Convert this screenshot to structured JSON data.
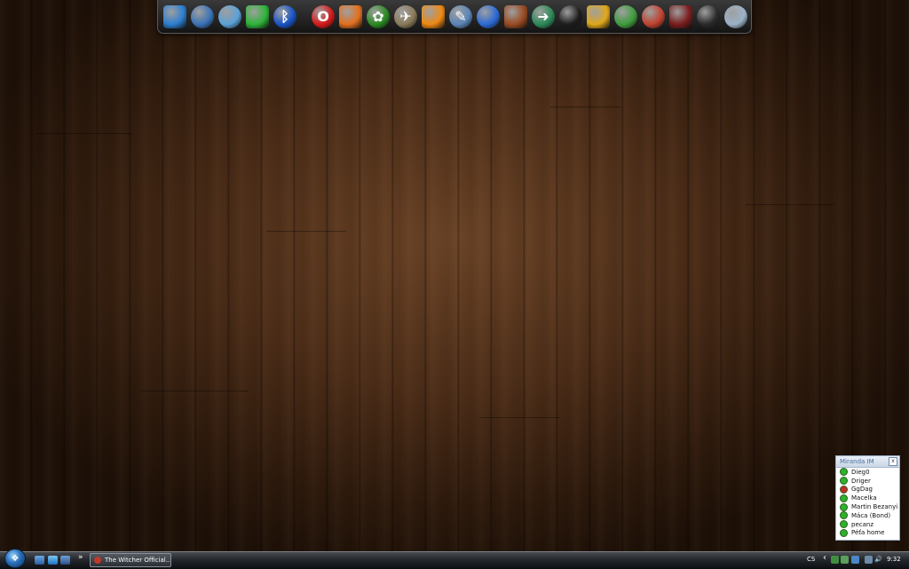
{
  "dock": {
    "icons": [
      {
        "name": "computer-monitor-icon",
        "glyph": "",
        "bg": "#2d7fd1"
      },
      {
        "name": "floppy-save-icon",
        "glyph": "",
        "bg": "#3a72b7"
      },
      {
        "name": "network-devices-icon",
        "glyph": "",
        "bg": "#5aa2d8"
      },
      {
        "name": "green-orb-icon",
        "glyph": "",
        "bg": "#2fb43a"
      },
      {
        "name": "bluetooth-icon",
        "glyph": "ᛒ",
        "bg": "#1853c6"
      },
      {
        "name": "opera-browser-icon",
        "glyph": "O",
        "bg": "#d61a1a"
      },
      {
        "name": "firefox-browser-icon",
        "glyph": "",
        "bg": "#e4701e"
      },
      {
        "name": "icq-flower-icon",
        "glyph": "✿",
        "bg": "#2a8a22"
      },
      {
        "name": "satellite-tools-icon",
        "glyph": "✈",
        "bg": "#8a7a5a"
      },
      {
        "name": "orange-sun-icon",
        "glyph": "",
        "bg": "#f08a12"
      },
      {
        "name": "pen-editor-icon",
        "glyph": "✎",
        "bg": "#5b86b8"
      },
      {
        "name": "water-drop-icon",
        "glyph": "",
        "bg": "#2b6ad6"
      },
      {
        "name": "fire-disc-icon",
        "glyph": "",
        "bg": "#9a4b23"
      },
      {
        "name": "document-arrow-icon",
        "glyph": "➜",
        "bg": "#2c8a58"
      },
      {
        "name": "black-monitor-icon",
        "glyph": "",
        "bg": "#1d1d1d"
      },
      {
        "name": "hexagon-honeycomb-icon",
        "glyph": "",
        "bg": "#e0a81a"
      },
      {
        "name": "globe-network-icon",
        "glyph": "",
        "bg": "#3e9c3c"
      },
      {
        "name": "pencil-eraser-icon",
        "glyph": "",
        "bg": "#c0412e"
      },
      {
        "name": "character-portrait-icon",
        "glyph": "",
        "bg": "#7a1d1d"
      },
      {
        "name": "witcher-wolf-icon",
        "glyph": "",
        "bg": "#2a2a2a"
      },
      {
        "name": "recycle-bin-icon",
        "glyph": "",
        "bg": "#9bb3c8"
      }
    ]
  },
  "miranda": {
    "title": "Miranda IM",
    "close_label": "x",
    "contacts": [
      {
        "name": "Dieg0",
        "color": "#2bb32b"
      },
      {
        "name": "Driger",
        "color": "#2bb32b"
      },
      {
        "name": "GgDag",
        "color": "#c62a2a"
      },
      {
        "name": "Macelka",
        "color": "#2bb32b"
      },
      {
        "name": "Martin Bezanyi",
        "color": "#2bb32b"
      },
      {
        "name": "Máca (Bond)",
        "color": "#2bb32b"
      },
      {
        "name": "pecanz",
        "color": "#2bb32b"
      },
      {
        "name": "Péťa home",
        "color": "#2bb32b"
      }
    ]
  },
  "taskbar": {
    "quick_launch_more": "»",
    "window_button_label": "The Witcher Official...",
    "language": "CS",
    "tray_arrow": "‹",
    "volume_glyph": "🔊",
    "clock": "9:32"
  }
}
